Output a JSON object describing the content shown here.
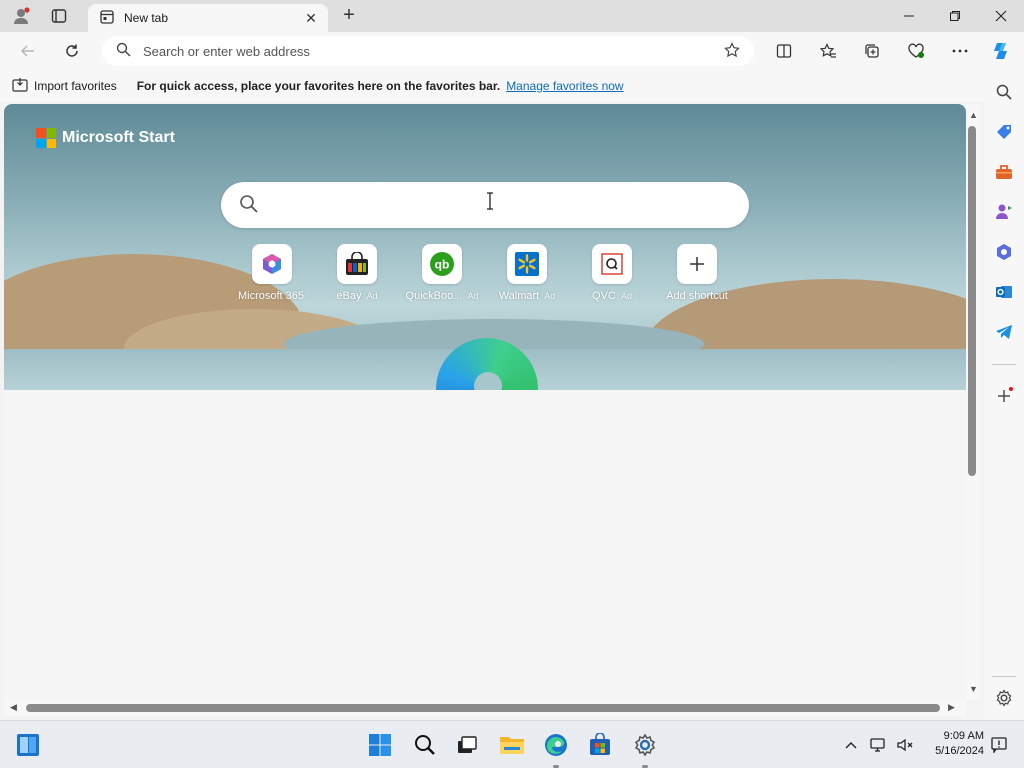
{
  "browser": {
    "tab": {
      "title": "New tab"
    },
    "address_bar": {
      "placeholder": "Search or enter web address"
    },
    "favorites_bar": {
      "import_label": "Import favorites",
      "tip": "For quick access, place your favorites here on the favorites bar.",
      "manage_link": "Manage favorites now"
    }
  },
  "newtab": {
    "brand": "Microsoft Start",
    "shortcuts": [
      {
        "label": "Microsoft 365",
        "ad": "",
        "icon": "microsoft365-icon"
      },
      {
        "label": "eBay",
        "ad": "Ad",
        "icon": "ebay-icon"
      },
      {
        "label": "QuickBoo...",
        "ad": "Ad",
        "icon": "quickbooks-icon"
      },
      {
        "label": "Walmart",
        "ad": "Ad",
        "icon": "walmart-icon"
      },
      {
        "label": "QVC",
        "ad": "Ad",
        "icon": "qvc-icon"
      },
      {
        "label": "Add shortcut",
        "ad": "",
        "icon": "plus-icon"
      }
    ]
  },
  "sidebar": {
    "items": [
      "search-icon",
      "shopping-tag-icon",
      "tools-icon",
      "games-icon",
      "microsoft365-icon",
      "outlook-icon",
      "telegram-icon",
      "add-icon",
      "settings-icon"
    ]
  },
  "taskbar": {
    "time": "9:09 AM",
    "date": "5/16/2024"
  },
  "colors": {
    "accent": "#0f6cbd",
    "taskbar": "#e9edf2",
    "hero_sky": "#6e97a2"
  }
}
